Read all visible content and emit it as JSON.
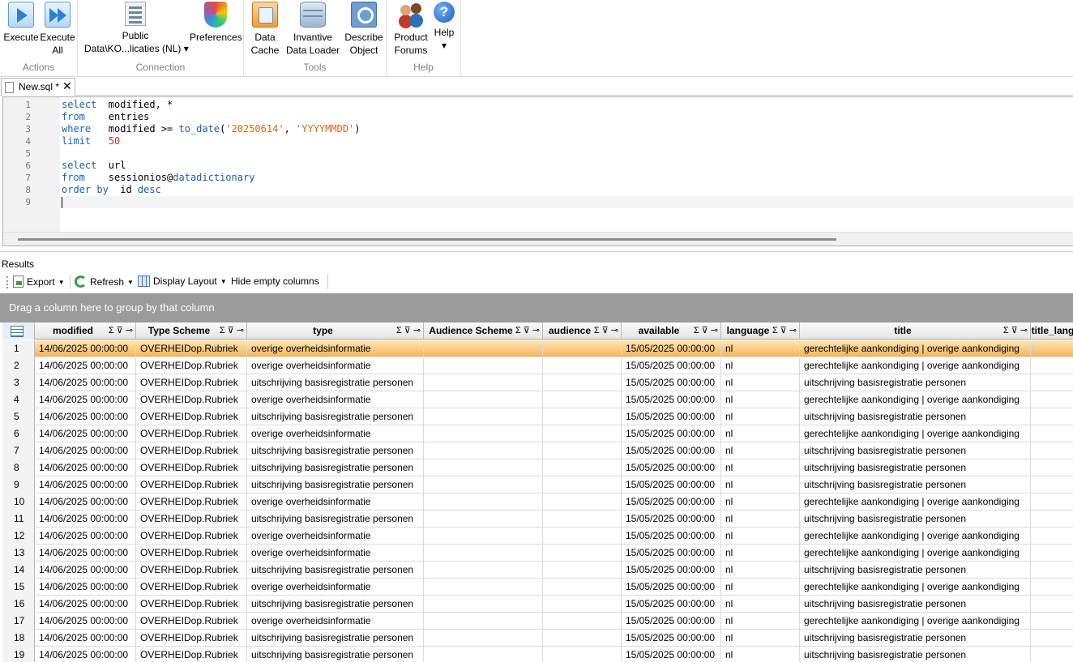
{
  "ribbon": {
    "actions": {
      "label": "Actions",
      "execute": "Execute",
      "execute_all_1": "Execute",
      "execute_all_2": "All"
    },
    "connection": {
      "label": "Connection",
      "public_1": "Public",
      "public_2": "Data\\KO...licaties (NL) ▾",
      "preferences": "Preferences"
    },
    "tools": {
      "label": "Tools",
      "cache_1": "Data",
      "cache_2": "Cache",
      "loader_1": "Invantive",
      "loader_2": "Data Loader",
      "describe_1": "Describe",
      "describe_2": "Object"
    },
    "help": {
      "label": "Help",
      "forums_1": "Product",
      "forums_2": "Forums",
      "help_1": "Help",
      "help_2": "▾"
    }
  },
  "tab": {
    "name": "New.sql *",
    "close": "✕"
  },
  "editor": {
    "lines": [
      {
        "n": "1",
        "parts": [
          [
            "kw",
            "select"
          ],
          [
            "",
            "  modified, *"
          ]
        ]
      },
      {
        "n": "2",
        "parts": [
          [
            "kw",
            "from"
          ],
          [
            "",
            "    entries"
          ]
        ]
      },
      {
        "n": "3",
        "parts": [
          [
            "kw",
            "where"
          ],
          [
            "",
            "   modified >= "
          ],
          [
            "kw",
            "to_date"
          ],
          [
            "",
            "("
          ],
          [
            "str",
            "'20250614'"
          ],
          [
            "",
            ", "
          ],
          [
            "str",
            "'YYYYMMDD'"
          ],
          [
            "",
            ")"
          ]
        ]
      },
      {
        "n": "4",
        "parts": [
          [
            "kw",
            "limit"
          ],
          [
            "",
            "   "
          ],
          [
            "num",
            "50"
          ]
        ]
      },
      {
        "n": "5",
        "parts": []
      },
      {
        "n": "6",
        "parts": [
          [
            "kw",
            "select"
          ],
          [
            "",
            "  url"
          ]
        ]
      },
      {
        "n": "7",
        "parts": [
          [
            "kw",
            "from"
          ],
          [
            "",
            "    sessionios@"
          ],
          [
            "kw",
            "datadictionary"
          ]
        ]
      },
      {
        "n": "8",
        "parts": [
          [
            "kw",
            "order by"
          ],
          [
            "",
            ""
          ],
          [
            "",
            "  id "
          ],
          [
            "kw",
            "desc"
          ]
        ]
      },
      {
        "n": "9",
        "parts": []
      }
    ]
  },
  "results": {
    "label": "Results",
    "toolbar": {
      "export": "Export",
      "refresh": "Refresh",
      "display_layout": "Display Layout",
      "hide_empty": "Hide empty columns"
    },
    "group_hint": "Drag a column here to group by that column",
    "header_ctrl": "Σ ⊽ ⊸",
    "columns": [
      "modified",
      "Type Scheme",
      "type",
      "Audience Scheme",
      "audience",
      "available",
      "language",
      "title",
      "title_lang"
    ],
    "rows": [
      [
        "1",
        "14/06/2025 00:00:00",
        "OVERHEIDop.Rubriek",
        "overige overheidsinformatie",
        "",
        "",
        "15/05/2025 00:00:00",
        "nl",
        "gerechtelijke aankondiging | overige aankondiging"
      ],
      [
        "2",
        "14/06/2025 00:00:00",
        "OVERHEIDop.Rubriek",
        "overige overheidsinformatie",
        "",
        "",
        "15/05/2025 00:00:00",
        "nl",
        "gerechtelijke aankondiging | overige aankondiging"
      ],
      [
        "3",
        "14/06/2025 00:00:00",
        "OVERHEIDop.Rubriek",
        "uitschrijving basisregistratie personen",
        "",
        "",
        "15/05/2025 00:00:00",
        "nl",
        "uitschrijving basisregistratie personen"
      ],
      [
        "4",
        "14/06/2025 00:00:00",
        "OVERHEIDop.Rubriek",
        "overige overheidsinformatie",
        "",
        "",
        "15/05/2025 00:00:00",
        "nl",
        "gerechtelijke aankondiging | overige aankondiging"
      ],
      [
        "5",
        "14/06/2025 00:00:00",
        "OVERHEIDop.Rubriek",
        "uitschrijving basisregistratie personen",
        "",
        "",
        "15/05/2025 00:00:00",
        "nl",
        "uitschrijving basisregistratie personen"
      ],
      [
        "6",
        "14/06/2025 00:00:00",
        "OVERHEIDop.Rubriek",
        "overige overheidsinformatie",
        "",
        "",
        "15/05/2025 00:00:00",
        "nl",
        "gerechtelijke aankondiging | overige aankondiging"
      ],
      [
        "7",
        "14/06/2025 00:00:00",
        "OVERHEIDop.Rubriek",
        "uitschrijving basisregistratie personen",
        "",
        "",
        "15/05/2025 00:00:00",
        "nl",
        "uitschrijving basisregistratie personen"
      ],
      [
        "8",
        "14/06/2025 00:00:00",
        "OVERHEIDop.Rubriek",
        "uitschrijving basisregistratie personen",
        "",
        "",
        "15/05/2025 00:00:00",
        "nl",
        "uitschrijving basisregistratie personen"
      ],
      [
        "9",
        "14/06/2025 00:00:00",
        "OVERHEIDop.Rubriek",
        "uitschrijving basisregistratie personen",
        "",
        "",
        "15/05/2025 00:00:00",
        "nl",
        "uitschrijving basisregistratie personen"
      ],
      [
        "10",
        "14/06/2025 00:00:00",
        "OVERHEIDop.Rubriek",
        "overige overheidsinformatie",
        "",
        "",
        "15/05/2025 00:00:00",
        "nl",
        "gerechtelijke aankondiging | overige aankondiging"
      ],
      [
        "11",
        "14/06/2025 00:00:00",
        "OVERHEIDop.Rubriek",
        "uitschrijving basisregistratie personen",
        "",
        "",
        "15/05/2025 00:00:00",
        "nl",
        "uitschrijving basisregistratie personen"
      ],
      [
        "12",
        "14/06/2025 00:00:00",
        "OVERHEIDop.Rubriek",
        "overige overheidsinformatie",
        "",
        "",
        "15/05/2025 00:00:00",
        "nl",
        "gerechtelijke aankondiging | overige aankondiging"
      ],
      [
        "13",
        "14/06/2025 00:00:00",
        "OVERHEIDop.Rubriek",
        "overige overheidsinformatie",
        "",
        "",
        "15/05/2025 00:00:00",
        "nl",
        "gerechtelijke aankondiging | overige aankondiging"
      ],
      [
        "14",
        "14/06/2025 00:00:00",
        "OVERHEIDop.Rubriek",
        "uitschrijving basisregistratie personen",
        "",
        "",
        "15/05/2025 00:00:00",
        "nl",
        "uitschrijving basisregistratie personen"
      ],
      [
        "15",
        "14/06/2025 00:00:00",
        "OVERHEIDop.Rubriek",
        "overige overheidsinformatie",
        "",
        "",
        "15/05/2025 00:00:00",
        "nl",
        "gerechtelijke aankondiging | overige aankondiging"
      ],
      [
        "16",
        "14/06/2025 00:00:00",
        "OVERHEIDop.Rubriek",
        "uitschrijving basisregistratie personen",
        "",
        "",
        "15/05/2025 00:00:00",
        "nl",
        "uitschrijving basisregistratie personen"
      ],
      [
        "17",
        "14/06/2025 00:00:00",
        "OVERHEIDop.Rubriek",
        "overige overheidsinformatie",
        "",
        "",
        "15/05/2025 00:00:00",
        "nl",
        "gerechtelijke aankondiging | overige aankondiging"
      ],
      [
        "18",
        "14/06/2025 00:00:00",
        "OVERHEIDop.Rubriek",
        "uitschrijving basisregistratie personen",
        "",
        "",
        "15/05/2025 00:00:00",
        "nl",
        "uitschrijving basisregistratie personen"
      ],
      [
        "19",
        "14/06/2025 00:00:00",
        "OVERHEIDop.Rubriek",
        "uitschrijving basisregistratie personen",
        "",
        "",
        "15/05/2025 00:00:00",
        "nl",
        "uitschrijving basisregistratie personen"
      ]
    ],
    "selected_row": 1
  }
}
